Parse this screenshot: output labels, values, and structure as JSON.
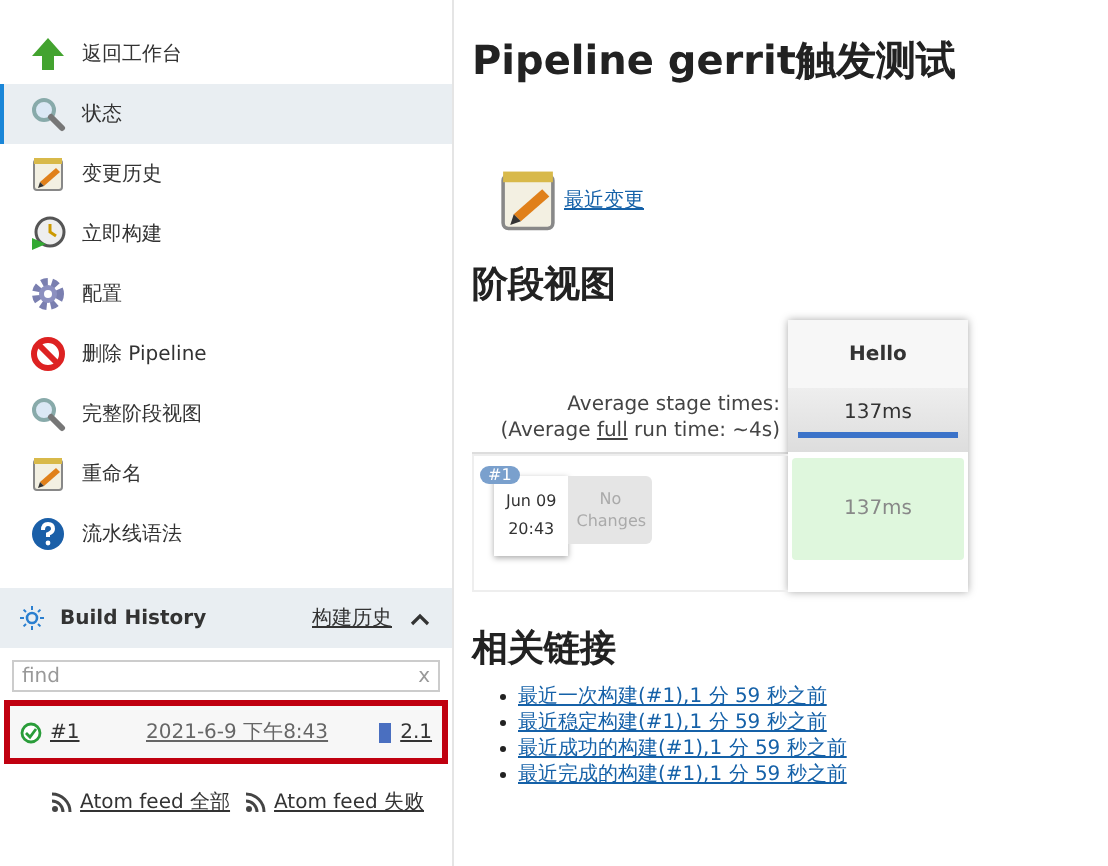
{
  "sidebar": {
    "items": [
      {
        "label": "返回工作台",
        "selected": false
      },
      {
        "label": "状态",
        "selected": true
      },
      {
        "label": "变更历史",
        "selected": false
      },
      {
        "label": "立即构建",
        "selected": false
      },
      {
        "label": "配置",
        "selected": false
      },
      {
        "label": "删除 Pipeline",
        "selected": false
      },
      {
        "label": "完整阶段视图",
        "selected": false
      },
      {
        "label": "重命名",
        "selected": false
      },
      {
        "label": "流水线语法",
        "selected": false
      }
    ]
  },
  "build_history": {
    "title": "Build History",
    "link": "构建历史",
    "expanded": true,
    "search": {
      "placeholder": "find",
      "clear": "x"
    },
    "builds": [
      {
        "number": "#1",
        "time": "2021-6-9 下午8:43",
        "version": "2.1",
        "kind": "success",
        "selected": true
      }
    ],
    "feeds": [
      "Atom feed 全部",
      "Atom feed 失败"
    ]
  },
  "main": {
    "title": "Pipeline gerrit触发测试",
    "recent_changes": "最近变更",
    "stage_view": {
      "heading": "阶段视图",
      "stages": [
        {
          "name": "Hello",
          "average": "137ms",
          "level": 1.0
        }
      ],
      "average_label": "Average stage times:",
      "run_time_prefix": "(Average ",
      "run_time_link": "full",
      "run_time_suffix": " run time: ~4s)",
      "runs": [
        {
          "badge": "#1",
          "date": "Jun 09",
          "time": "20:43",
          "changes": "No Changes",
          "durations": [
            "137ms"
          ]
        }
      ]
    },
    "related": {
      "heading": "相关链接",
      "links": [
        "最近一次构建(#1),1 分 59 秒之前",
        "最近稳定构建(#1),1 分 59 秒之前",
        "最近成功的构建(#1),1 分 59 秒之前",
        "最近完成的构建(#1),1 分 59 秒之前"
      ]
    }
  }
}
